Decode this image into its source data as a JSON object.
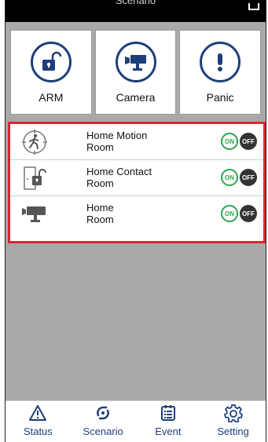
{
  "colors": {
    "brand": "#1e3f7a",
    "selection_border": "#d9282f",
    "on_green": "#2aa84a",
    "off_dark": "#333333",
    "content_bg": "#a9a9a9"
  },
  "header": {
    "title": "Scenario"
  },
  "quick_actions": [
    {
      "label": "ARM",
      "icon": "unlocked-padlock-icon"
    },
    {
      "label": "Camera",
      "icon": "camera-icon"
    },
    {
      "label": "Panic",
      "icon": "exclamation-icon"
    }
  ],
  "devices": [
    {
      "name": "Home Motion",
      "room": "Room",
      "icon": "motion-sensor-icon",
      "on_label": "ON",
      "off_label": "OFF"
    },
    {
      "name": "Home Contact",
      "room": "Room",
      "icon": "door-contact-icon",
      "on_label": "ON",
      "off_label": "OFF"
    },
    {
      "name": "Home",
      "room": "Room",
      "icon": "camera-icon",
      "on_label": "ON",
      "off_label": "OFF"
    }
  ],
  "tabs": [
    {
      "label": "Status",
      "icon": "warning-triangle-icon"
    },
    {
      "label": "Scenario",
      "icon": "scenario-icon"
    },
    {
      "label": "Event",
      "icon": "event-list-icon"
    },
    {
      "label": "Setting",
      "icon": "gear-icon"
    }
  ]
}
